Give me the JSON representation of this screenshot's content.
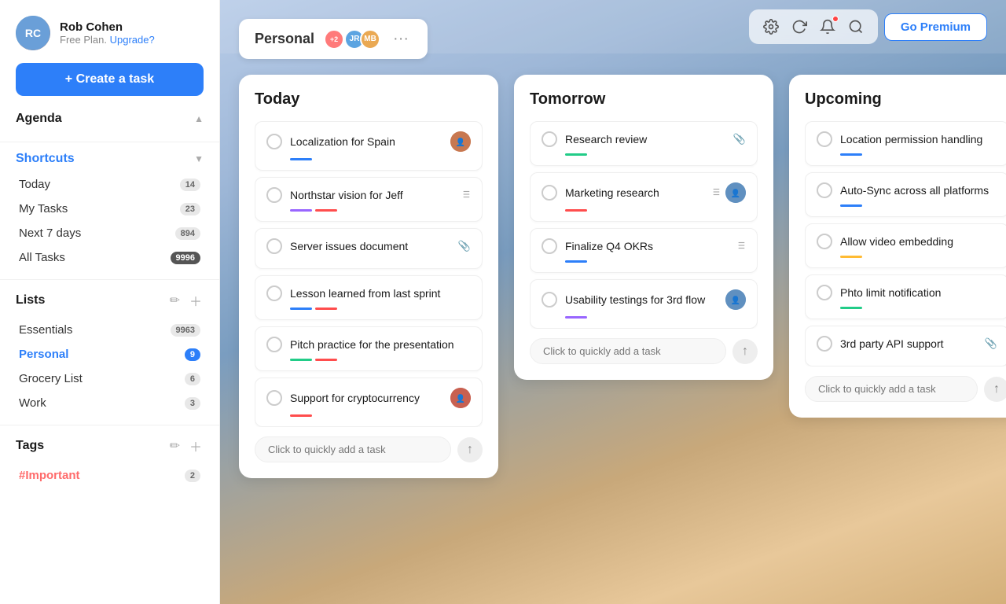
{
  "sidebar": {
    "profile": {
      "name": "Rob Cohen",
      "plan": "Free Plan.",
      "upgrade_label": "Upgrade?",
      "initials": "RC"
    },
    "create_button_label": "+ Create a task",
    "agenda": {
      "title": "Agenda",
      "expanded": true
    },
    "shortcuts": {
      "title": "Shortcuts",
      "expanded": true,
      "items": [
        {
          "label": "Today",
          "badge": "14",
          "badge_type": "gray",
          "active": false
        },
        {
          "label": "My Tasks",
          "badge": "23",
          "badge_type": "gray",
          "active": false
        },
        {
          "label": "Next 7 days",
          "badge": "894",
          "badge_type": "gray",
          "active": false
        },
        {
          "label": "All Tasks",
          "badge": "9996",
          "badge_type": "dark",
          "active": false
        }
      ]
    },
    "lists": {
      "title": "Lists",
      "expanded": true,
      "items": [
        {
          "label": "Essentials",
          "badge": "9963",
          "badge_type": "gray",
          "active": false
        },
        {
          "label": "Personal",
          "badge": "9",
          "badge_type": "blue",
          "active": true
        },
        {
          "label": "Grocery List",
          "badge": "6",
          "badge_type": "gray",
          "active": false
        },
        {
          "label": "Work",
          "badge": "3",
          "badge_type": "gray",
          "active": false
        }
      ]
    },
    "tags": {
      "title": "Tags",
      "expanded": true,
      "items": [
        {
          "label": "#Important",
          "badge": "2",
          "badge_type": "gray"
        }
      ]
    }
  },
  "topbar": {
    "icons": [
      "⚙",
      "↺",
      "🔔",
      "🔍"
    ],
    "go_premium": "Go Premium"
  },
  "board": {
    "title": "Personal",
    "columns": [
      {
        "id": "today",
        "title": "Today",
        "tasks": [
          {
            "id": 1,
            "title": "Localization for Spain",
            "bar_color": "bar-blue",
            "avatar": "1",
            "has_avatar": true
          },
          {
            "id": 2,
            "title": "Northstar vision for Jeff",
            "bar_colors": [
              "bar-purple",
              "bar-red"
            ],
            "has_icon": true
          },
          {
            "id": 3,
            "title": "Server issues document",
            "has_attach": true
          },
          {
            "id": 4,
            "title": "Lesson learned from last sprint",
            "bar_colors": [
              "bar-blue",
              "bar-red"
            ]
          },
          {
            "id": 5,
            "title": "Pitch practice for the presentation",
            "bar_colors": [
              "bar-green",
              "bar-red"
            ]
          },
          {
            "id": 6,
            "title": "Support for cryptocurrency",
            "bar_color": "bar-red",
            "avatar": "3",
            "has_avatar": true
          }
        ],
        "add_placeholder": "Click to quickly add a task"
      },
      {
        "id": "tomorrow",
        "title": "Tomorrow",
        "tasks": [
          {
            "id": 7,
            "title": "Research review",
            "bar_color": "bar-green",
            "has_attach": true
          },
          {
            "id": 8,
            "title": "Marketing research",
            "bar_color": "bar-red",
            "avatar": "2",
            "has_avatar": true,
            "has_icon": true
          },
          {
            "id": 9,
            "title": "Finalize Q4 OKRs",
            "bar_color": "bar-blue",
            "has_icon": true
          },
          {
            "id": 10,
            "title": "Usability testings for 3rd flow",
            "bar_color": "bar-purple",
            "avatar": "2",
            "has_avatar": true
          }
        ],
        "add_placeholder": "Click to quickly add a task"
      },
      {
        "id": "upcoming",
        "title": "Upcoming",
        "tasks": [
          {
            "id": 11,
            "title": "Location permission handling",
            "bar_color": "bar-blue"
          },
          {
            "id": 12,
            "title": "Auto-Sync across all platforms",
            "bar_color": "bar-blue"
          },
          {
            "id": 13,
            "title": "Allow video embedding",
            "bar_color": "bar-yellow"
          },
          {
            "id": 14,
            "title": "Phto limit notification",
            "bar_color": "bar-green"
          },
          {
            "id": 15,
            "title": "3rd party API support",
            "has_attach": true
          }
        ],
        "add_placeholder": "Click to quickly add a task"
      }
    ]
  }
}
